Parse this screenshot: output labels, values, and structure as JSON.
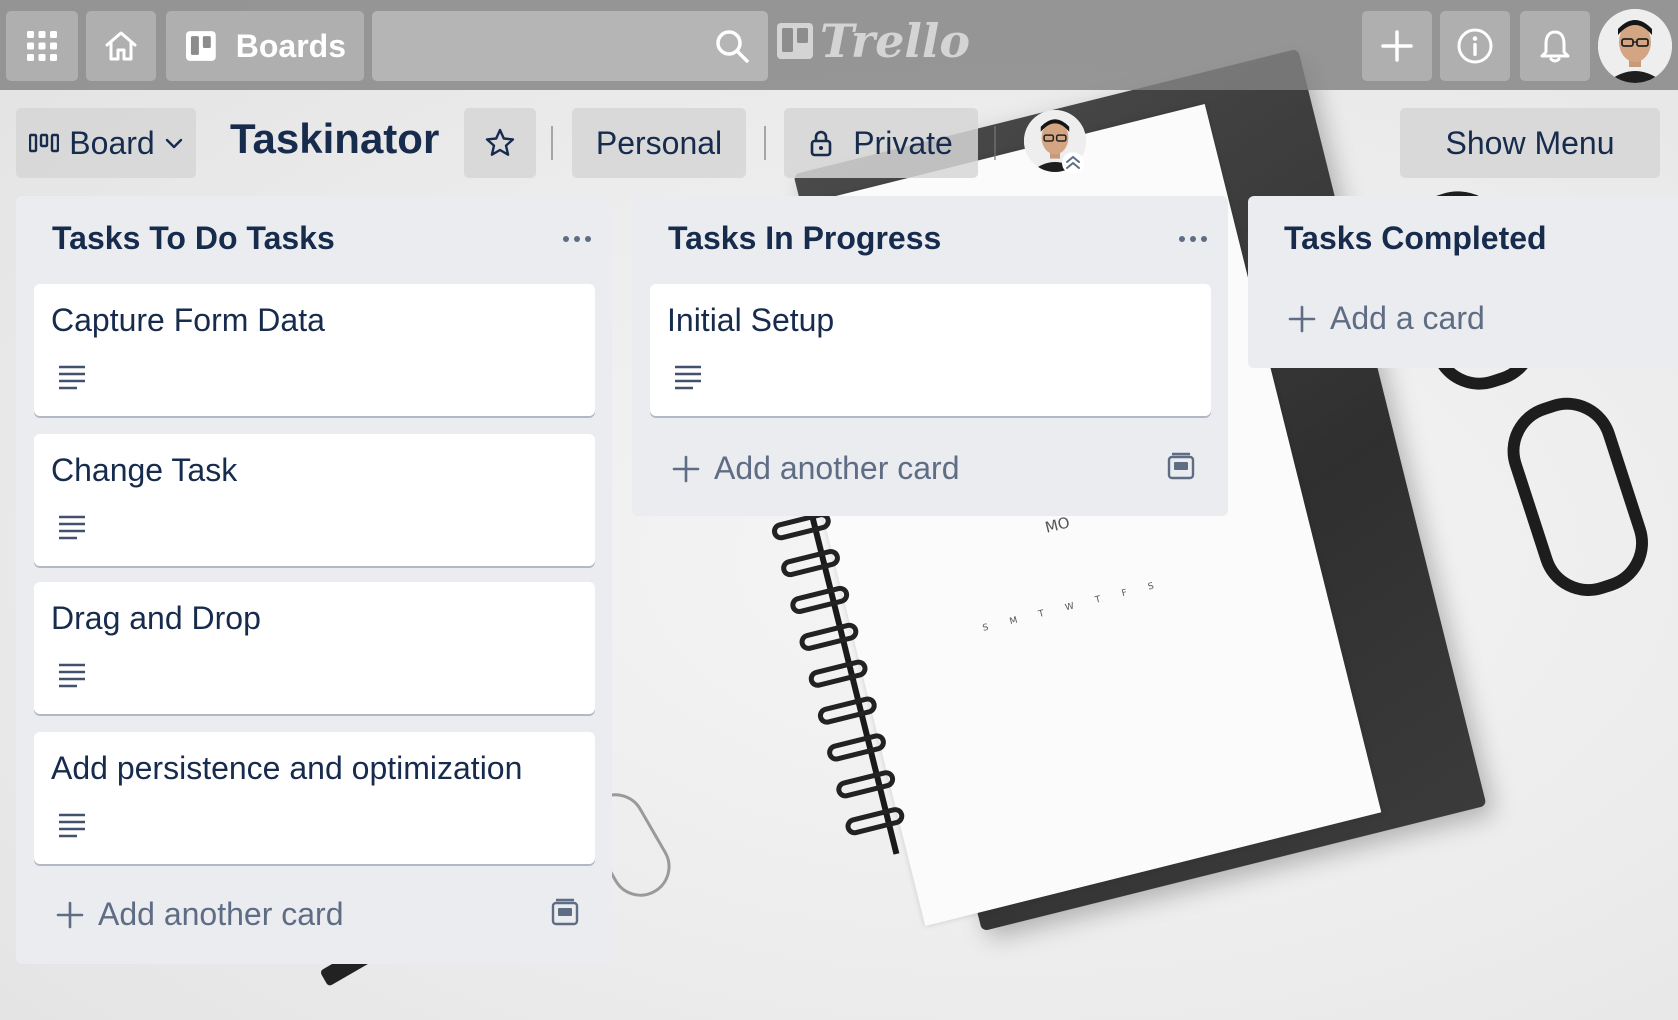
{
  "topbar": {
    "boards_label": "Boards",
    "logo_text": "Trello"
  },
  "board": {
    "view_label": "Board",
    "title": "Taskinator",
    "team_label": "Personal",
    "visibility_label": "Private",
    "show_menu_label": "Show Menu"
  },
  "lists": [
    {
      "title": "Tasks To Do Tasks",
      "cards": [
        {
          "title": "Capture Form Data"
        },
        {
          "title": "Change Task"
        },
        {
          "title": "Drag and Drop"
        },
        {
          "title": "Add persistence and optimization"
        }
      ],
      "add_label": "Add another card"
    },
    {
      "title": "Tasks In Progress",
      "cards": [
        {
          "title": "Initial Setup"
        }
      ],
      "add_label": "Add another card"
    },
    {
      "title": "Tasks Completed",
      "cards": [],
      "add_label": "Add a card"
    }
  ],
  "background": {
    "calendar_text": "MO",
    "weekdays": [
      "S",
      "M",
      "T",
      "W",
      "T",
      "F",
      "S"
    ]
  },
  "colors": {
    "topbar": "#828282",
    "list_bg": "#ebecf0",
    "text": "#172b4d",
    "muted": "#5e6c84"
  }
}
